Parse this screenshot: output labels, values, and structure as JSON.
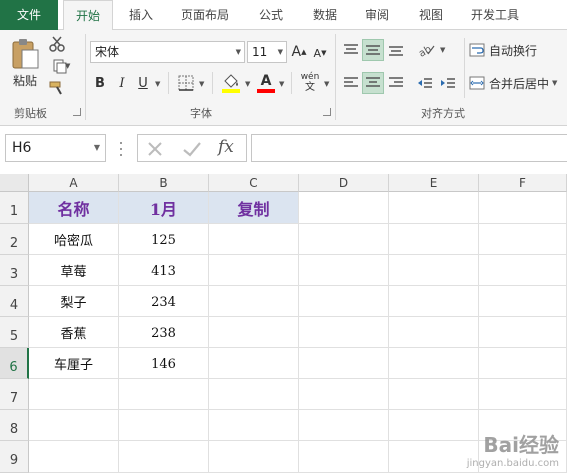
{
  "tabs": [
    "文件",
    "开始",
    "插入",
    "页面布局",
    "公式",
    "数据",
    "审阅",
    "视图",
    "开发工具"
  ],
  "ribbon": {
    "clipboard": {
      "paste_label": "粘贴",
      "group_label": "剪贴板"
    },
    "font": {
      "name": "宋体",
      "size": "11",
      "grow_label": "A",
      "shrink_label": "A",
      "bold": "B",
      "italic": "I",
      "underline": "U",
      "font_color_letter": "A",
      "phonetic_label": "wén",
      "group_label": "字体",
      "fill_color": "#ffff00",
      "font_color": "#ff0000"
    },
    "alignment": {
      "wrap_label": "自动换行",
      "merge_label": "合并后居中",
      "group_label": "对齐方式"
    }
  },
  "formula_bar": {
    "name_box": "H6",
    "fx_label": "fx",
    "formula": ""
  },
  "grid": {
    "columns": [
      "A",
      "B",
      "C",
      "D",
      "E",
      "F"
    ],
    "rows": [
      "1",
      "2",
      "3",
      "4",
      "5",
      "6",
      "7",
      "8",
      "9"
    ],
    "headers": {
      "a": "名称",
      "b": "1月",
      "c": "复制"
    },
    "data": [
      {
        "a": "哈密瓜",
        "b": "125"
      },
      {
        "a": "草莓",
        "b": "413"
      },
      {
        "a": "梨子",
        "b": "234"
      },
      {
        "a": "香蕉",
        "b": "238"
      },
      {
        "a": "车厘子",
        "b": "146"
      }
    ],
    "selected_row": "6"
  },
  "watermark": {
    "brand": "Bai经验",
    "url": "jingyan.baidu.com"
  }
}
